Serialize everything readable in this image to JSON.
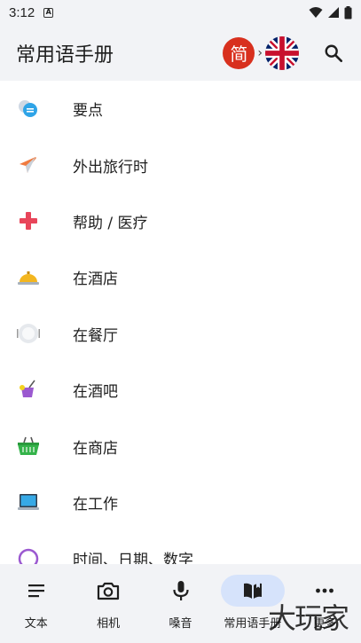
{
  "status": {
    "time": "3:12",
    "badge": "A"
  },
  "header": {
    "title": "常用语手册",
    "source_lang": "简",
    "arrow": "›"
  },
  "categories": [
    {
      "label": "要点",
      "icon": "chat-bubbles-icon"
    },
    {
      "label": "外出旅行时",
      "icon": "airplane-icon"
    },
    {
      "label": "帮助 / 医疗",
      "icon": "medical-cross-icon"
    },
    {
      "label": "在酒店",
      "icon": "service-bell-icon"
    },
    {
      "label": "在餐厅",
      "icon": "plate-icon"
    },
    {
      "label": "在酒吧",
      "icon": "cocktail-icon"
    },
    {
      "label": "在商店",
      "icon": "shopping-basket-icon"
    },
    {
      "label": "在工作",
      "icon": "laptop-icon"
    },
    {
      "label": "时间、日期、数字",
      "icon": "clock-icon"
    }
  ],
  "nav": [
    {
      "label": "文本",
      "icon": "text-lines-icon"
    },
    {
      "label": "相机",
      "icon": "camera-icon"
    },
    {
      "label": "嗓音",
      "icon": "microphone-icon"
    },
    {
      "label": "常用语手册",
      "icon": "phrasebook-icon",
      "active": true
    },
    {
      "label": "更多",
      "icon": "more-dots-icon"
    }
  ],
  "watermark": "大玩家",
  "colors": {
    "bar_bg": "#f2f3f6",
    "active_pill": "#d6e3fb",
    "zh_badge": "#d8301e"
  }
}
